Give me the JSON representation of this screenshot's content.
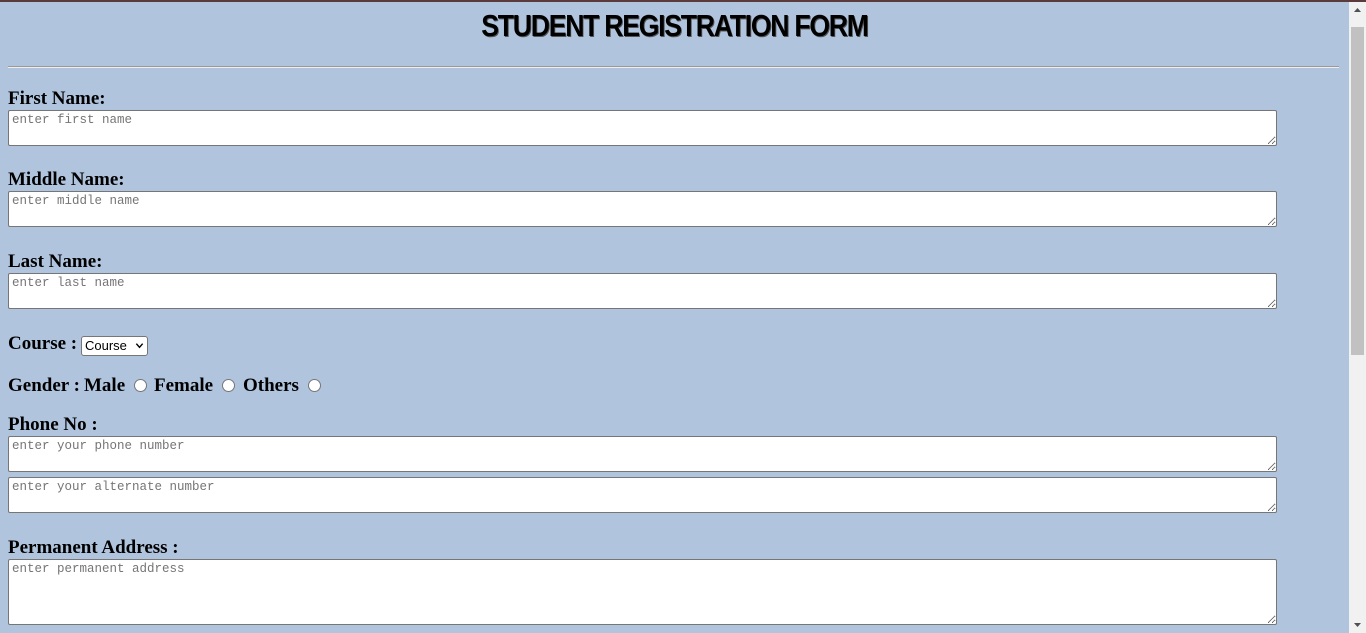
{
  "form": {
    "title": "STUDENT REGISTRATION FORM",
    "first_name": {
      "label": "First Name:",
      "placeholder": "enter first name"
    },
    "middle_name": {
      "label": "Middle Name:",
      "placeholder": "enter middle name"
    },
    "last_name": {
      "label": "Last Name:",
      "placeholder": "enter last name"
    },
    "course": {
      "label": "Course :",
      "selected": "Course"
    },
    "gender": {
      "label": "Gender :",
      "options": [
        "Male",
        "Female",
        "Others"
      ]
    },
    "phone": {
      "label": "Phone No :",
      "placeholder": "enter your phone number",
      "alt_placeholder": "enter your alternate number"
    },
    "address": {
      "label": "Permanent Address :",
      "placeholder": "enter permanent address"
    }
  },
  "icons": {
    "select_arrow": "chevron-down-icon",
    "resize_grip": "resize-grip-icon",
    "scroll_up": "arrow-up-icon",
    "scroll_down": "arrow-down-icon"
  }
}
